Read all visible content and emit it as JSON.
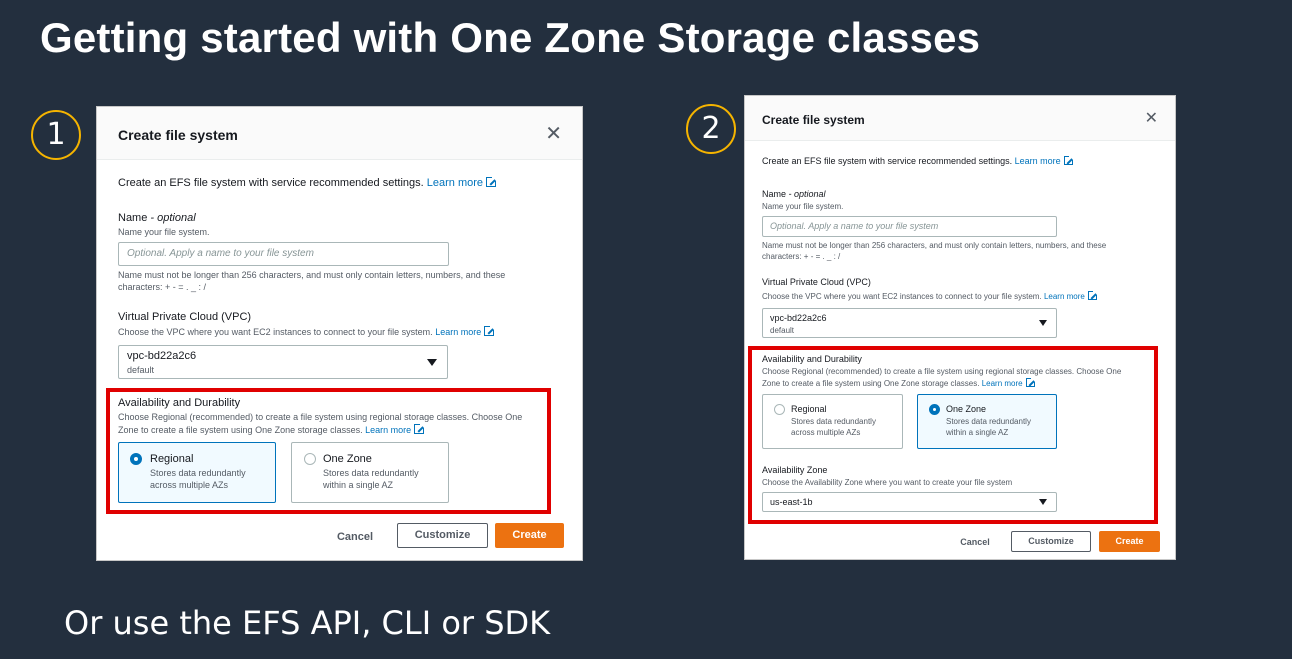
{
  "slide": {
    "title": "Getting started with One Zone Storage classes",
    "footer": "Or use the EFS API, CLI or SDK",
    "accent_color": "#f5b400",
    "highlight_color": "#e00000"
  },
  "steps": [
    "1",
    "2"
  ],
  "dialog1": {
    "title": "Create file system",
    "close_icon": "close-icon",
    "intro": "Create an EFS file system with service recommended settings.",
    "intro_link": "Learn more",
    "name_label": "Name",
    "name_optional": "- optional",
    "name_desc": "Name your file system.",
    "name_placeholder": "Optional. Apply a name to your file system",
    "name_constraint_1": "Name must not be longer than 256 characters, and must only contain letters, numbers, and these",
    "name_constraint_2": "characters: + - = . _ : /",
    "vpc_label": "Virtual Private Cloud (VPC)",
    "vpc_desc": "Choose the VPC where you want EC2 instances to connect to your file system.",
    "vpc_link": "Learn more",
    "vpc_value": "vpc-bd22a2c6",
    "vpc_sub": "default",
    "avail_label": "Availability and Durability",
    "avail_desc_1": "Choose Regional (recommended) to create a file system using regional storage classes. Choose One",
    "avail_desc_2": "Zone to create a file system using One Zone storage classes.",
    "avail_link": "Learn more",
    "regional_label": "Regional",
    "regional_desc_1": "Stores data redundantly",
    "regional_desc_2": "across multiple AZs",
    "onezone_label": "One Zone",
    "onezone_desc_1": "Stores data redundantly",
    "onezone_desc_2": "within a single AZ",
    "selected": "Regional",
    "cancel": "Cancel",
    "customize": "Customize",
    "create": "Create"
  },
  "dialog2": {
    "title": "Create file system",
    "close_icon": "close-icon",
    "intro": "Create an EFS file system with service recommended settings.",
    "intro_link": "Learn more",
    "name_label": "Name",
    "name_optional": "- optional",
    "name_desc": "Name your file system.",
    "name_placeholder": "Optional. Apply a name to your file system",
    "name_constraint_1": "Name must not be longer than 256 characters, and must only contain letters, numbers, and these",
    "name_constraint_2": "characters: + - = . _ : /",
    "vpc_label": "Virtual Private Cloud (VPC)",
    "vpc_desc": "Choose the VPC where you want EC2 instances to connect to your file system.",
    "vpc_link": "Learn more",
    "vpc_value": "vpc-bd22a2c6",
    "vpc_sub": "default",
    "avail_label": "Availability and Durability",
    "avail_desc_1": "Choose Regional (recommended) to create a file system using regional storage classes. Choose One",
    "avail_desc_2": "Zone to create a file system using One Zone storage classes.",
    "avail_link": "Learn more",
    "regional_label": "Regional",
    "regional_desc_1": "Stores data redundantly",
    "regional_desc_2": "across multiple AZs",
    "onezone_label": "One Zone",
    "onezone_desc_1": "Stores data redundantly",
    "onezone_desc_2": "within a single AZ",
    "selected": "One Zone",
    "az_label": "Availability Zone",
    "az_desc": "Choose the Availability Zone where you want to create your file system",
    "az_value": "us-east-1b",
    "cancel": "Cancel",
    "customize": "Customize",
    "create": "Create"
  }
}
